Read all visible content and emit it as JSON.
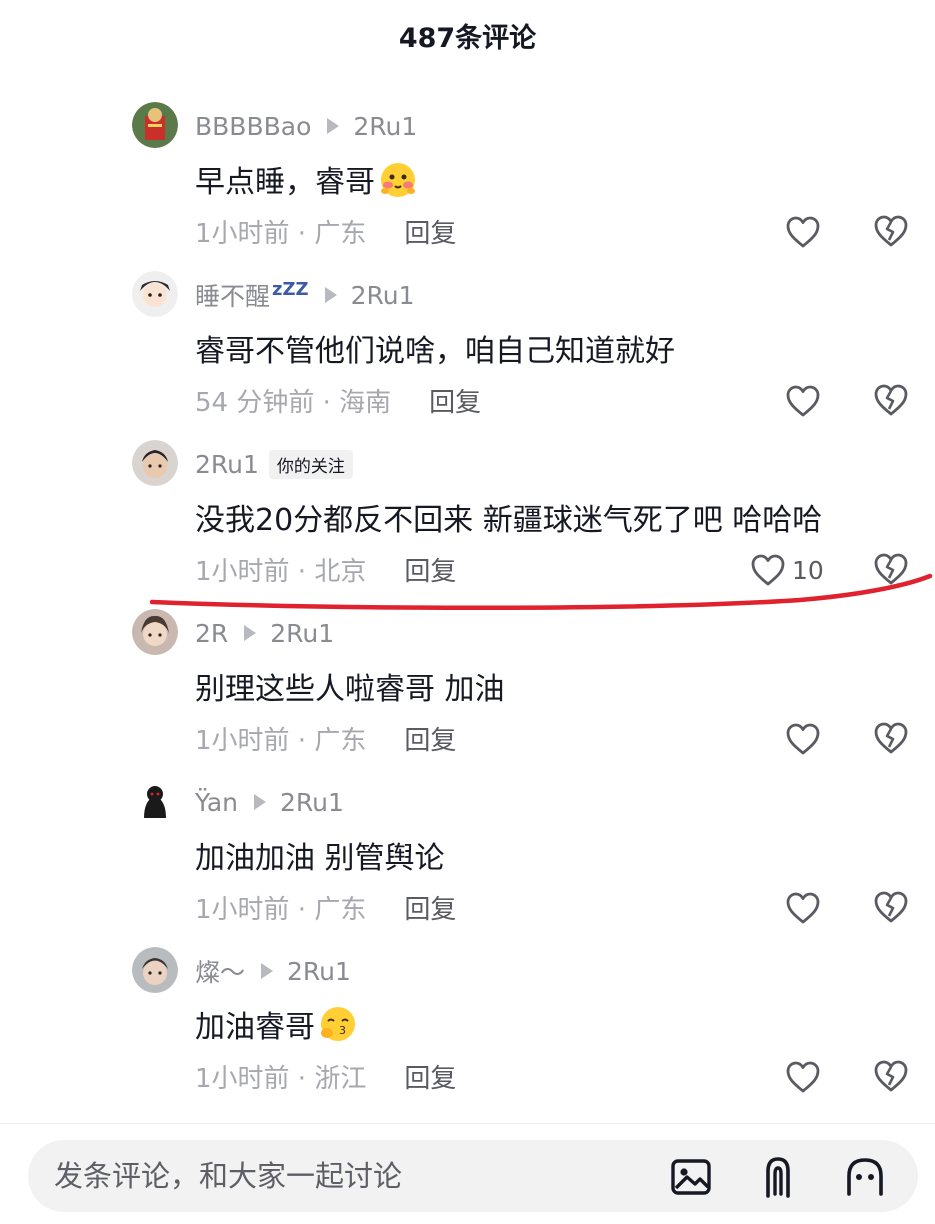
{
  "header": {
    "title": "487条评论"
  },
  "comments": [
    {
      "username": "BBBBBao",
      "reply_to": "2Ru1",
      "text": "早点睡，睿哥",
      "time_location": "1小时前 · 广东",
      "reply_label": "回复",
      "avatar_icon": "avatar-image",
      "emoji": "blushing-face-emoji"
    },
    {
      "username": "睡不醒",
      "username_suffix": "zZZ",
      "reply_to": "2Ru1",
      "text": "睿哥不管他们说啥，咱自己知道就好",
      "time_location": "54 分钟前 · 海南",
      "reply_label": "回复",
      "avatar_icon": "avatar-image"
    },
    {
      "username": "2Ru1",
      "badge": "你的关注",
      "text": "没我20分都反不回来 新疆球迷气死了吧 哈哈哈",
      "time_location": "1小时前 · 北京",
      "reply_label": "回复",
      "like_count": "10",
      "avatar_icon": "avatar-image",
      "annotation": "red-hand-drawn-underline"
    },
    {
      "username": "2R",
      "reply_to": "2Ru1",
      "text": "别理这些人啦睿哥 加油",
      "time_location": "1小时前 · 广东",
      "reply_label": "回复",
      "avatar_icon": "avatar-image"
    },
    {
      "username": "Ÿan",
      "reply_to": "2Ru1",
      "text": "加油加油 别管舆论",
      "time_location": "1小时前 · 广东",
      "reply_label": "回复",
      "avatar_icon": "avatar-image"
    },
    {
      "username": "燦～",
      "reply_to": "2Ru1",
      "text": "加油睿哥",
      "time_location": "1小时前 · 浙江",
      "reply_label": "回复",
      "avatar_icon": "avatar-image",
      "emoji": "kissing-face-emoji"
    }
  ],
  "bottom_bar": {
    "placeholder": "发条评论，和大家一起讨论",
    "icons": [
      "image-icon",
      "at-icon",
      "emoji-icon"
    ]
  },
  "colors": {
    "text_primary": "#161823",
    "text_secondary": "#8a8b91",
    "annotation_red": "#e0212e",
    "input_bg": "#f2f2f3"
  }
}
